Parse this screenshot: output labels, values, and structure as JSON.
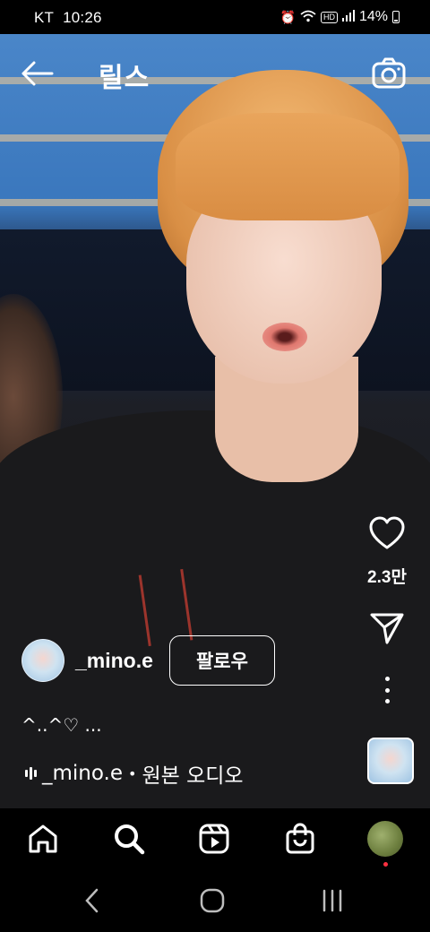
{
  "status_bar": {
    "carrier": "KT",
    "time": "10:26",
    "network_badge": "HD",
    "battery_percent": "14%"
  },
  "header": {
    "title": "릴스"
  },
  "reel": {
    "likes": "2.3만",
    "creator": {
      "username": "_mino.e",
      "follow_label": "팔로우"
    },
    "caption": "^..^♡ ...",
    "audio": {
      "artist": "_mino.e",
      "separator": "•",
      "track": "원본 오디오"
    }
  },
  "icons": {
    "back": "back-arrow-icon",
    "camera": "camera-icon",
    "like": "heart-icon",
    "share": "send-icon",
    "more": "more-vertical-icon",
    "home": "home-icon",
    "search": "search-icon",
    "reels": "reels-icon",
    "shop": "shopping-bag-icon"
  },
  "colors": {
    "background": "#000000",
    "text": "#ffffff",
    "notification_dot": "#ff3040"
  }
}
